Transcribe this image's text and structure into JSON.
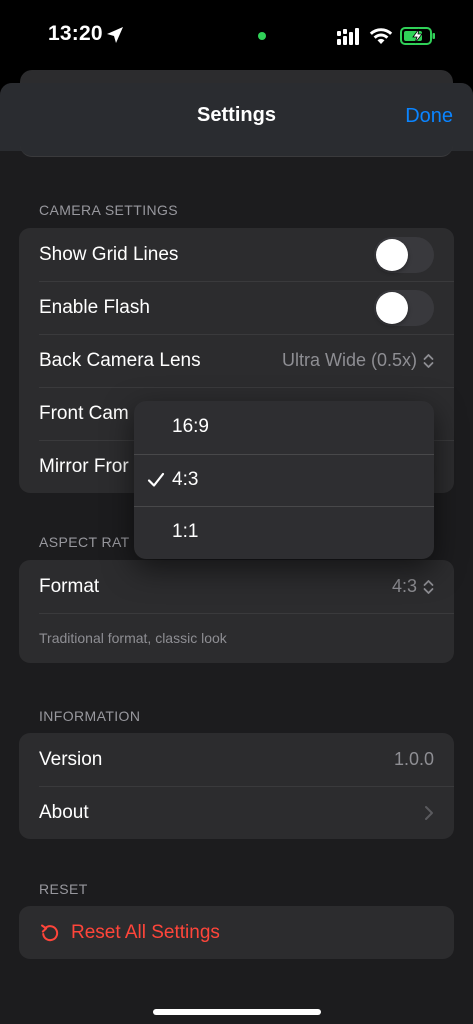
{
  "status_bar": {
    "time": "13:20"
  },
  "nav": {
    "title": "Settings",
    "done_label": "Done"
  },
  "camera_settings": {
    "header": "CAMERA SETTINGS",
    "show_grid_lines": {
      "label": "Show Grid Lines",
      "on": false
    },
    "enable_flash": {
      "label": "Enable Flash",
      "on": false
    },
    "back_camera_lens": {
      "label": "Back Camera Lens",
      "value": "Ultra Wide (0.5x)"
    },
    "front_camera": {
      "label": "Front Cam"
    },
    "mirror_front": {
      "label": "Mirror Fror",
      "on": true
    }
  },
  "aspect_ratio": {
    "header": "ASPECT RAT",
    "format": {
      "label": "Format",
      "value": "4:3"
    },
    "footer": "Traditional format, classic look"
  },
  "information": {
    "header": "INFORMATION",
    "version": {
      "label": "Version",
      "value": "1.0.0"
    },
    "about": {
      "label": "About"
    }
  },
  "reset": {
    "header": "RESET",
    "button_label": "Reset All Settings"
  },
  "format_menu": {
    "options": [
      "16:9",
      "4:3",
      "1:1"
    ],
    "selected": "4:3"
  },
  "colors": {
    "accent": "#0a84ff",
    "destructive": "#ff453a",
    "toggle_on": "#30d158",
    "camera_indicator": "#30d158"
  }
}
